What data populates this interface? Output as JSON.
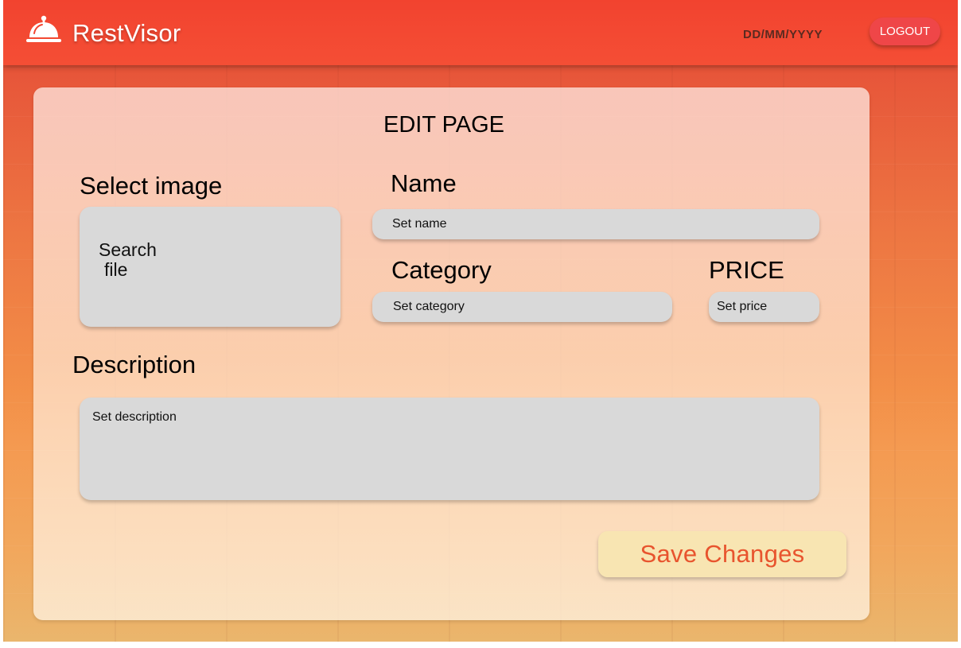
{
  "header": {
    "brand": "RestVisor",
    "date": "DD/MM/YYYY",
    "logout_label": "LOGOUT",
    "logo_icon": "cloche-icon"
  },
  "form": {
    "title": "EDIT PAGE",
    "image_label": "Select image",
    "file_text_line1": "Search",
    "file_text_line2": "file",
    "name_label": "Name",
    "name_placeholder": "Set name",
    "category_label": "Category",
    "category_placeholder": "Set category",
    "price_label": "PRICE",
    "price_placeholder": "Set price",
    "description_label": "Description",
    "description_placeholder": "Set description",
    "save_label": "Save Changes"
  },
  "colors": {
    "header_red": "#f2432f",
    "logout_bg": "#ef4648",
    "save_bg": "#f8e5b2",
    "save_text": "#e8542e",
    "field_bg": "#d9d9d9"
  }
}
